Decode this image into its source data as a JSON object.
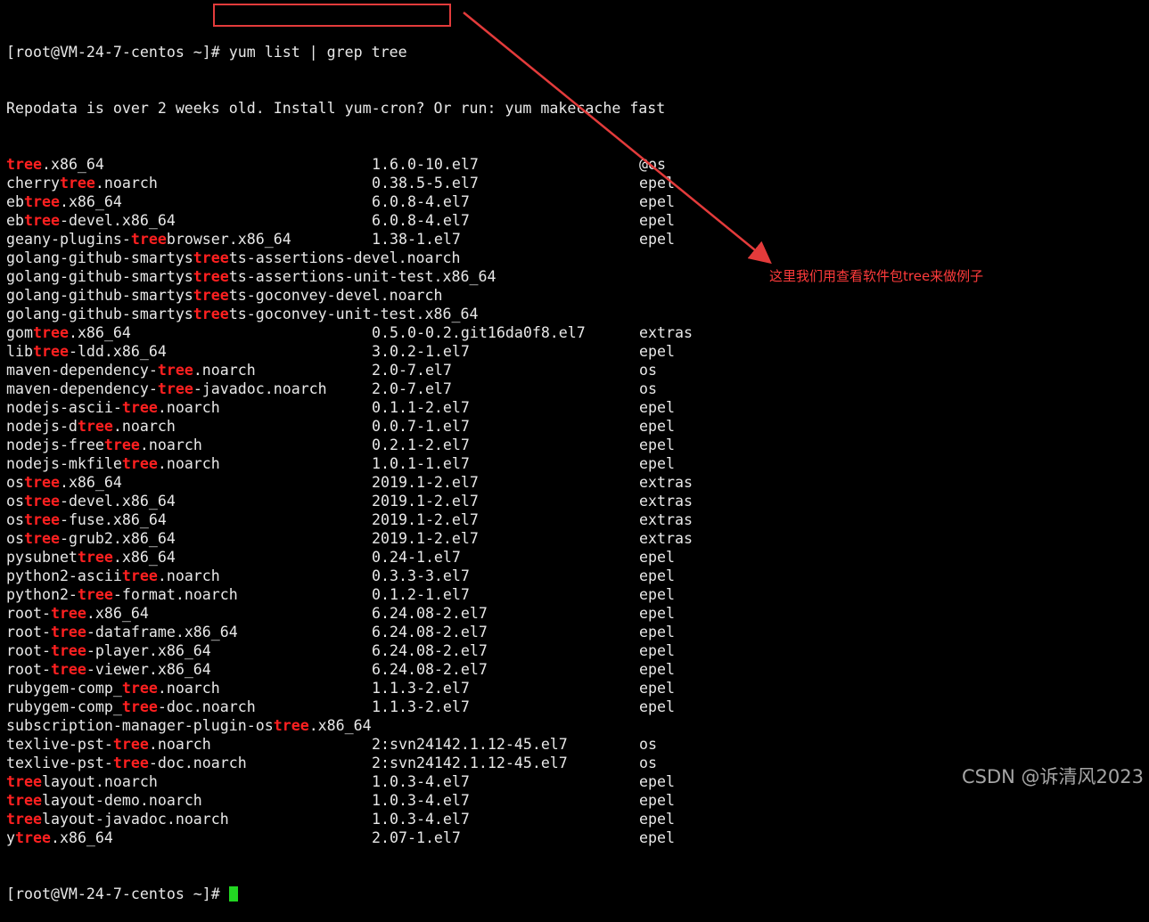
{
  "terminal": {
    "prompt": "[root@VM-24-7-centos ~]#",
    "command": " yum list | grep tree",
    "repodata_warning": "Repodata is over 2 weeks old. Install yum-cron? Or run: yum makecache fast",
    "final_prompt": "[root@VM-24-7-centos ~]#",
    "packages": [
      {
        "pre": "",
        "hl": "tree",
        "post": ".x86_64",
        "version": "1.6.0-10.el7",
        "repo": "@os"
      },
      {
        "pre": "cherry",
        "hl": "tree",
        "post": ".noarch",
        "version": "0.38.5-5.el7",
        "repo": "epel"
      },
      {
        "pre": "eb",
        "hl": "tree",
        "post": ".x86_64",
        "version": "6.0.8-4.el7",
        "repo": "epel"
      },
      {
        "pre": "eb",
        "hl": "tree",
        "post": "-devel.x86_64",
        "version": "6.0.8-4.el7",
        "repo": "epel"
      },
      {
        "pre": "geany-plugins-",
        "hl": "tree",
        "post": "browser.x86_64",
        "version": "1.38-1.el7",
        "repo": "epel"
      },
      {
        "pre": "golang-github-smartys",
        "hl": "tree",
        "post": "ts-assertions-devel.noarch",
        "version": "",
        "repo": ""
      },
      {
        "pre": "golang-github-smartys",
        "hl": "tree",
        "post": "ts-assertions-unit-test.x86_64",
        "version": "",
        "repo": ""
      },
      {
        "pre": "golang-github-smartys",
        "hl": "tree",
        "post": "ts-goconvey-devel.noarch",
        "version": "",
        "repo": ""
      },
      {
        "pre": "golang-github-smartys",
        "hl": "tree",
        "post": "ts-goconvey-unit-test.x86_64",
        "version": "",
        "repo": ""
      },
      {
        "pre": "gom",
        "hl": "tree",
        "post": ".x86_64",
        "version": "0.5.0-0.2.git16da0f8.el7",
        "repo": "extras"
      },
      {
        "pre": "lib",
        "hl": "tree",
        "post": "-ldd.x86_64",
        "version": "3.0.2-1.el7",
        "repo": "epel"
      },
      {
        "pre": "maven-dependency-",
        "hl": "tree",
        "post": ".noarch",
        "version": "2.0-7.el7",
        "repo": "os"
      },
      {
        "pre": "maven-dependency-",
        "hl": "tree",
        "post": "-javadoc.noarch",
        "version": "2.0-7.el7",
        "repo": "os"
      },
      {
        "pre": "nodejs-ascii-",
        "hl": "tree",
        "post": ".noarch",
        "version": "0.1.1-2.el7",
        "repo": "epel"
      },
      {
        "pre": "nodejs-d",
        "hl": "tree",
        "post": ".noarch",
        "version": "0.0.7-1.el7",
        "repo": "epel"
      },
      {
        "pre": "nodejs-free",
        "hl": "tree",
        "post": ".noarch",
        "version": "0.2.1-2.el7",
        "repo": "epel"
      },
      {
        "pre": "nodejs-mkfile",
        "hl": "tree",
        "post": ".noarch",
        "version": "1.0.1-1.el7",
        "repo": "epel"
      },
      {
        "pre": "os",
        "hl": "tree",
        "post": ".x86_64",
        "version": "2019.1-2.el7",
        "repo": "extras"
      },
      {
        "pre": "os",
        "hl": "tree",
        "post": "-devel.x86_64",
        "version": "2019.1-2.el7",
        "repo": "extras"
      },
      {
        "pre": "os",
        "hl": "tree",
        "post": "-fuse.x86_64",
        "version": "2019.1-2.el7",
        "repo": "extras"
      },
      {
        "pre": "os",
        "hl": "tree",
        "post": "-grub2.x86_64",
        "version": "2019.1-2.el7",
        "repo": "extras"
      },
      {
        "pre": "pysubnet",
        "hl": "tree",
        "post": ".x86_64",
        "version": "0.24-1.el7",
        "repo": "epel"
      },
      {
        "pre": "python2-ascii",
        "hl": "tree",
        "post": ".noarch",
        "version": "0.3.3-3.el7",
        "repo": "epel"
      },
      {
        "pre": "python2-",
        "hl": "tree",
        "post": "-format.noarch",
        "version": "0.1.2-1.el7",
        "repo": "epel"
      },
      {
        "pre": "root-",
        "hl": "tree",
        "post": ".x86_64",
        "version": "6.24.08-2.el7",
        "repo": "epel"
      },
      {
        "pre": "root-",
        "hl": "tree",
        "post": "-dataframe.x86_64",
        "version": "6.24.08-2.el7",
        "repo": "epel"
      },
      {
        "pre": "root-",
        "hl": "tree",
        "post": "-player.x86_64",
        "version": "6.24.08-2.el7",
        "repo": "epel"
      },
      {
        "pre": "root-",
        "hl": "tree",
        "post": "-viewer.x86_64",
        "version": "6.24.08-2.el7",
        "repo": "epel"
      },
      {
        "pre": "rubygem-comp_",
        "hl": "tree",
        "post": ".noarch",
        "version": "1.1.3-2.el7",
        "repo": "epel"
      },
      {
        "pre": "rubygem-comp_",
        "hl": "tree",
        "post": "-doc.noarch",
        "version": "1.1.3-2.el7",
        "repo": "epel"
      },
      {
        "pre": "subscription-manager-plugin-os",
        "hl": "tree",
        "post": ".x86_64",
        "version": "",
        "repo": ""
      },
      {
        "pre": "texlive-pst-",
        "hl": "tree",
        "post": ".noarch",
        "version": "2:svn24142.1.12-45.el7",
        "repo": "os"
      },
      {
        "pre": "texlive-pst-",
        "hl": "tree",
        "post": "-doc.noarch",
        "version": "2:svn24142.1.12-45.el7",
        "repo": "os"
      },
      {
        "pre": "",
        "hl": "tree",
        "post": "layout.noarch",
        "version": "1.0.3-4.el7",
        "repo": "epel"
      },
      {
        "pre": "",
        "hl": "tree",
        "post": "layout-demo.noarch",
        "version": "1.0.3-4.el7",
        "repo": "epel"
      },
      {
        "pre": "",
        "hl": "tree",
        "post": "layout-javadoc.noarch",
        "version": "1.0.3-4.el7",
        "repo": "epel"
      },
      {
        "pre": "y",
        "hl": "tree",
        "post": ".x86_64",
        "version": "2.07-1.el7",
        "repo": "epel"
      }
    ]
  },
  "annotation": {
    "note": "这里我们用查看软件包tree来做例子",
    "color": "#e33b3b"
  },
  "watermark": "CSDN @诉清风2023",
  "colors": {
    "background": "#000000",
    "text": "#e8e8e8",
    "highlight": "#ff2020",
    "cursor": "#22d622"
  }
}
